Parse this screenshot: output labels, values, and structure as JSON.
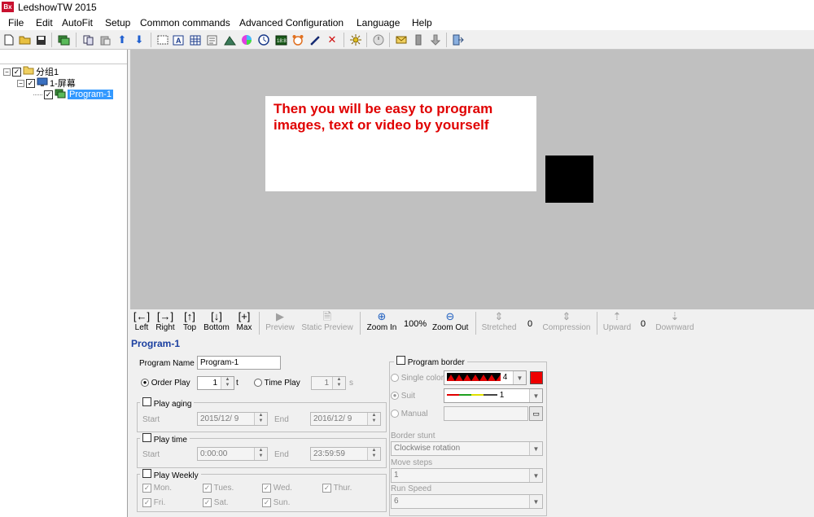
{
  "app": {
    "title": "LedshowTW 2015",
    "icon_text": "Bx"
  },
  "menu": [
    "File",
    "Edit",
    "AutoFit",
    "Setup",
    "Common commands",
    "Advanced Configuration",
    "Language",
    "Help"
  ],
  "toolbar_icons": [
    "new-file-icon",
    "open-folder-icon",
    "save-icon",
    "screen-icon",
    "copy-icon",
    "paste-icon",
    "move-up-icon",
    "move-down-icon",
    "rectangle-icon",
    "text-icon",
    "table-icon",
    "note-icon",
    "image-icon",
    "color-wheel-icon",
    "clock-icon",
    "counter-icon",
    "alarm-icon",
    "pen-icon",
    "delete-icon",
    "brightness-icon",
    "timer-icon",
    "send-icon",
    "usb-icon",
    "download-icon",
    "exit-icon"
  ],
  "tree": {
    "group": "分组1",
    "screen": "1-屏幕",
    "program": "Program-1"
  },
  "canvas": {
    "text": "Then you will be easy to program\nimages, text or video by yourself",
    "text_color": "#e00000"
  },
  "controls": {
    "left": "Left",
    "right": "Right",
    "top": "Top",
    "bottom": "Bottom",
    "max": "Max",
    "preview": "Preview",
    "static_preview": "Static Preview",
    "zoom_in": "Zoom In",
    "zoom_level": "100%",
    "zoom_out": "Zoom Out",
    "stretched": "Stretched",
    "stretch_value": "0",
    "compression": "Compression",
    "upward": "Upward",
    "move_value": "0",
    "downward": "Downward"
  },
  "program": {
    "title": "Program-1",
    "name_label": "Program Name",
    "name_value": "Program-1",
    "order_play": "Order Play",
    "order_value": "1",
    "order_unit": "t",
    "time_play": "Time Play",
    "time_value": "1",
    "time_unit": "s",
    "play_aging": "Play aging",
    "start": "Start",
    "end": "End",
    "aging_start": "2015/12/  9",
    "aging_end": "2016/12/  9",
    "play_time": "Play time",
    "time_start": "0:00:00",
    "time_end": "23:59:59",
    "play_weekly": "Play Weekly",
    "days": [
      "Mon.",
      "Tues.",
      "Wed.",
      "Thur.",
      "Fri.",
      "Sat.",
      "Sun."
    ]
  },
  "border": {
    "title": "Program border",
    "single_color": "Single color",
    "single_value": "4",
    "suit": "Suit",
    "suit_value": "1",
    "manual": "Manual",
    "border_stunt": "Border stunt",
    "stunt_value": "Clockwise rotation",
    "move_steps": "Move steps",
    "steps_value": "1",
    "run_speed": "Run Speed",
    "speed_value": "6",
    "swatch_color": "#ee0000"
  }
}
